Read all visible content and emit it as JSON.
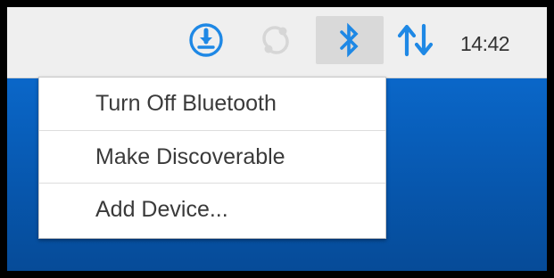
{
  "taskbar": {
    "clock": "14:42",
    "icons": [
      "update-download-icon",
      "sync-icon",
      "bluetooth-icon",
      "network-updown-arrows-icon"
    ]
  },
  "bluetooth_menu": {
    "items": [
      {
        "label": "Turn Off Bluetooth"
      },
      {
        "label": "Make Discoverable"
      },
      {
        "label": "Add Device..."
      }
    ]
  },
  "colors": {
    "accent": "#1e88e5",
    "desktop": "#0757ae",
    "taskbar": "#efefef",
    "menu_background": "#ffffff"
  }
}
